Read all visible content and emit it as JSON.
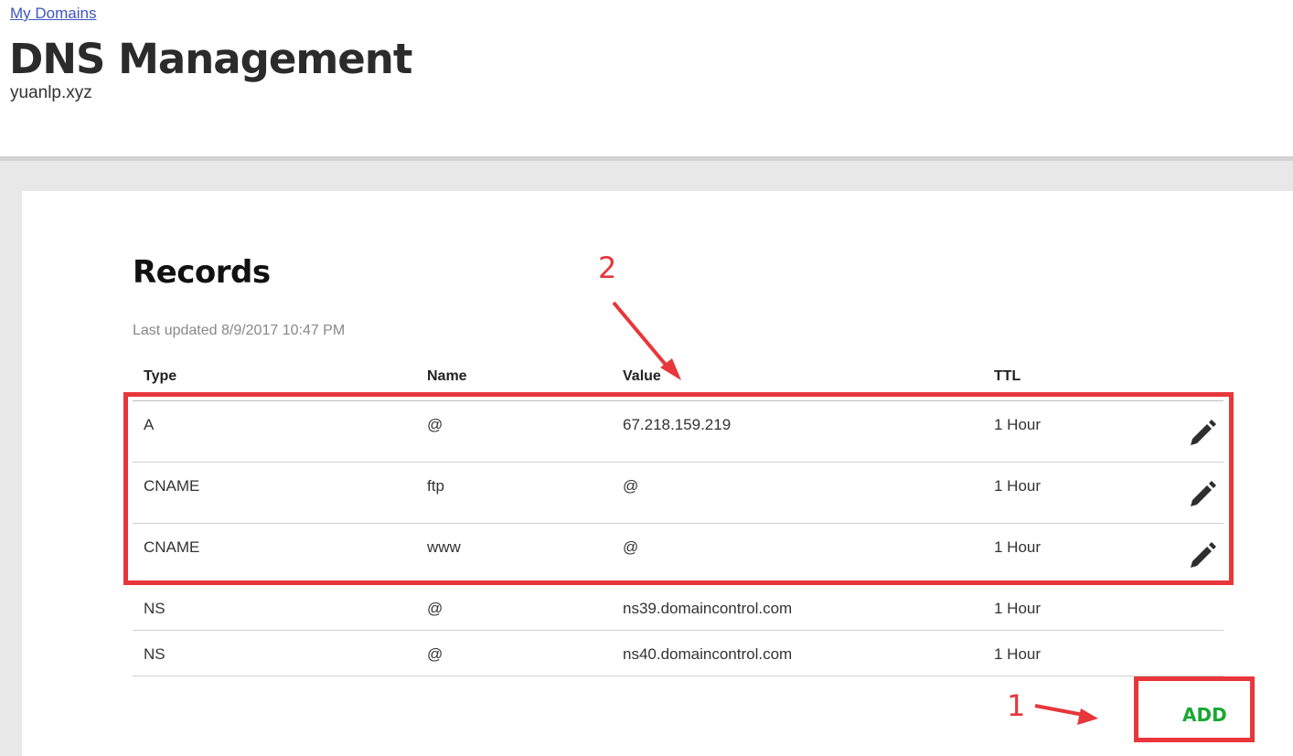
{
  "header": {
    "breadcrumb": "My Domains",
    "title": "DNS Management",
    "domain": "yuanlp.xyz"
  },
  "records": {
    "title": "Records",
    "last_updated": "Last updated 8/9/2017 10:47 PM",
    "columns": [
      "Type",
      "Name",
      "Value",
      "TTL"
    ],
    "rows": [
      {
        "type": "A",
        "name": "@",
        "value": "67.218.159.219",
        "ttl": "1 Hour",
        "editable": true
      },
      {
        "type": "CNAME",
        "name": "ftp",
        "value": "@",
        "ttl": "1 Hour",
        "editable": true
      },
      {
        "type": "CNAME",
        "name": "www",
        "value": "@",
        "ttl": "1 Hour",
        "editable": true
      },
      {
        "type": "NS",
        "name": "@",
        "value": "ns39.domaincontrol.com",
        "ttl": "1 Hour",
        "editable": false
      },
      {
        "type": "NS",
        "name": "@",
        "value": "ns40.domaincontrol.com",
        "ttl": "1 Hour",
        "editable": false
      }
    ],
    "add_label": "ADD"
  },
  "annotations": {
    "marker_1": "1",
    "marker_2": "2",
    "color": "#e8363a"
  },
  "colors": {
    "link": "#3d55c1",
    "add_button": "#1aa832",
    "annotation": "#e8363a"
  },
  "icons": {
    "edit": "pencil-icon"
  }
}
